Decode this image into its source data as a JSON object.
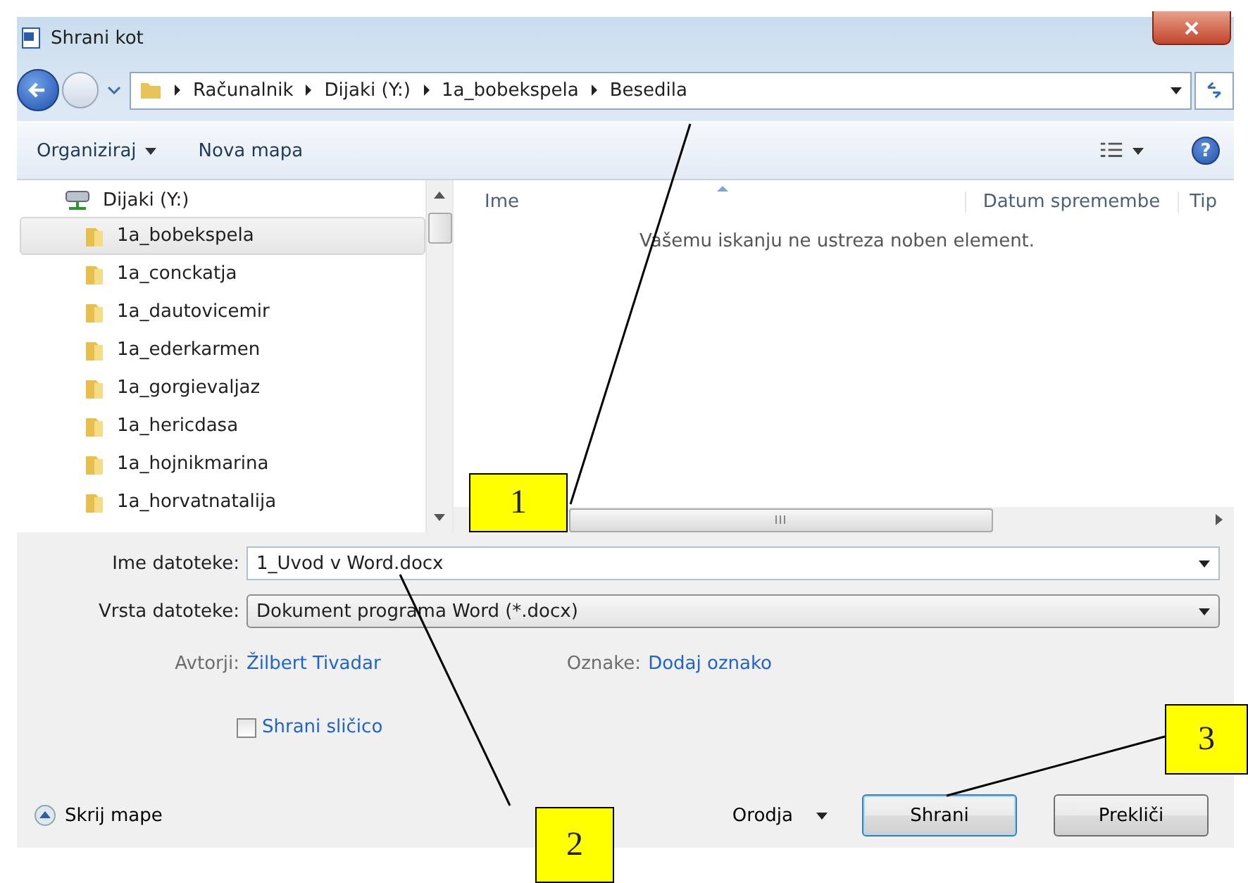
{
  "window": {
    "title": "Shrani kot"
  },
  "address_bar": {
    "crumbs": [
      "Računalnik",
      "Dijaki (Y:)",
      "1a_bobekspela",
      "Besedila"
    ]
  },
  "toolbar": {
    "organize": "Organiziraj",
    "new_folder": "Nova mapa",
    "help": "?"
  },
  "tree": {
    "root": {
      "label": "Dijaki (Y:)",
      "children": [
        {
          "label": "1a_bobekspela",
          "selected": true
        },
        {
          "label": "1a_conckatja",
          "selected": false
        },
        {
          "label": "1a_dautovicemir",
          "selected": false
        },
        {
          "label": "1a_ederkarmen",
          "selected": false
        },
        {
          "label": "1a_gorgievaljaz",
          "selected": false
        },
        {
          "label": "1a_hericdasa",
          "selected": false
        },
        {
          "label": "1a_hojnikmarina",
          "selected": false
        },
        {
          "label": "1a_horvatnatalija",
          "selected": false
        }
      ]
    }
  },
  "file_list": {
    "columns": [
      "Ime",
      "Datum spremembe",
      "Tip"
    ],
    "empty_message": "Vašemu iskanju ne ustreza noben element."
  },
  "form": {
    "filename_label": "Ime datoteke:",
    "filename_value": "1_Uvod v Word.docx",
    "filetype_label": "Vrsta datoteke:",
    "filetype_value": "Dokument programa Word (*.docx)",
    "authors_label": "Avtorji:",
    "authors_value": "Žilbert Tivadar",
    "tags_label": "Oznake:",
    "tags_value": "Dodaj oznako",
    "thumbnail": {
      "label": "Shrani sličico",
      "checked": false
    }
  },
  "footer": {
    "hide_folders": "Skrij mape",
    "tools": "Orodja",
    "save": "Shrani",
    "cancel": "Prekliči"
  },
  "callouts": [
    "1",
    "2",
    "3"
  ]
}
